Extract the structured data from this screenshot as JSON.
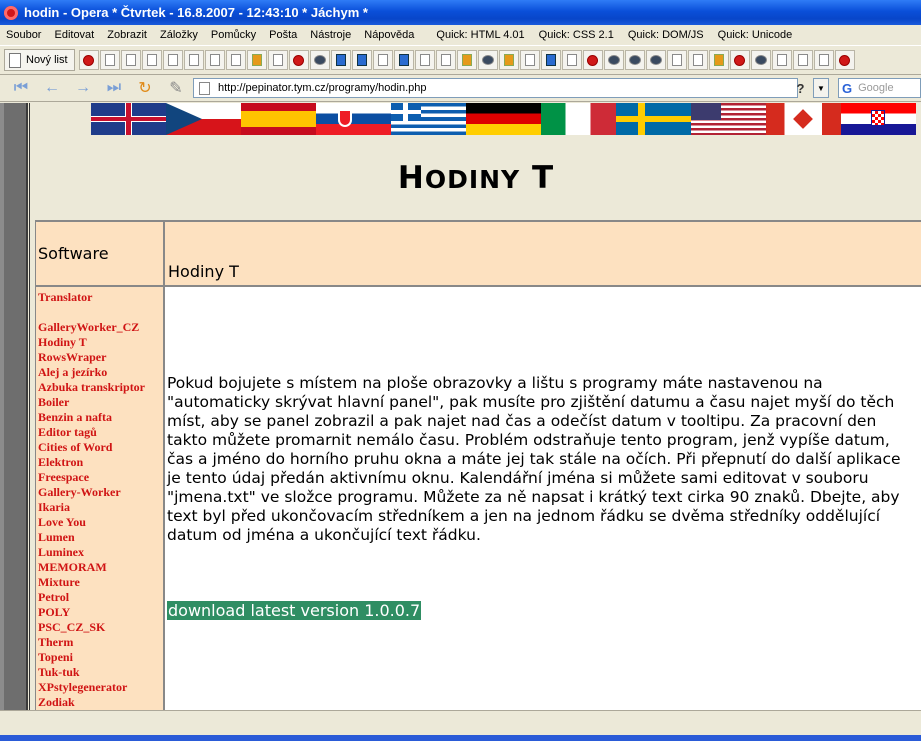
{
  "window": {
    "title": "hodin - Opera  * Čtvrtek - 16.8.2007 - 12:43:10 * Jáchym *"
  },
  "menu": {
    "items": [
      "Soubor",
      "Editovat",
      "Zobrazit",
      "Záložky",
      "Pomůcky",
      "Pošta",
      "Nástroje",
      "Nápověda"
    ],
    "quick": [
      "Quick: HTML 4.01",
      "Quick: CSS 2.1",
      "Quick: DOM/JS",
      "Quick: Unicode"
    ]
  },
  "toolbar": {
    "new_tab_label": "Nový list"
  },
  "address": {
    "url": "http://pepinator.tym.cz/programy/hodin.php",
    "search_placeholder": "Google",
    "help_label": "?"
  },
  "page": {
    "title_big": "H",
    "title_small": "ODINY",
    "title_big2": "T",
    "header_left": "Software",
    "header_right": "Hodiny T",
    "description": "Pokud bojujete s místem na ploše obrazovky a lištu s programy máte nastavenou na \"automaticky skrývat hlavní panel\", pak musíte pro zjištění datumu a času najet myší do těch míst, aby se panel zobrazil a pak najet nad čas a odečíst datum v tooltipu. Za pracovní den takto můžete promarnit nemálo času. Problém odstraňuje tento program, jenž vypíše datum, čas a jméno do horního pruhu okna a máte jej tak stále na očích. Při přepnutí do další aplikace je tento údaj předán aktivnímu oknu. Kalendářní jména si můžete sami editovat v souboru \"jmena.txt\" ve složce programu. Můžete za ně napsat i krátký text cirka 90 znaků. Dbejte, aby text byl před ukončovacím středníkem a jen na jednom řádku se dvěma středníky oddělující datum od jména a ukončující text řádku.",
    "download_label": "download latest version 1.0.0.7",
    "software_links": [
      "Translator",
      "",
      "GalleryWorker_CZ",
      "Hodiny T",
      "RowsWraper",
      "Alej a jezírko",
      "Azbuka transkriptor",
      "Boiler",
      "Benzin a nafta",
      "Editor tagů",
      "Cities of Word",
      "Elektron",
      "Freespace",
      "Gallery-Worker",
      "Ikaria",
      "Love You",
      "Lumen",
      "Luminex",
      "MEMORAM",
      "Mixture",
      "Petrol",
      "POLY",
      "PSC_CZ_SK",
      "Therm",
      "Topeni",
      "Tuk-tuk",
      "XPstylegenerator",
      "Zodiak"
    ]
  },
  "colors": {
    "link": "#d01414",
    "table_bg": "#fde1c0",
    "download_bg": "#2f8e63"
  }
}
